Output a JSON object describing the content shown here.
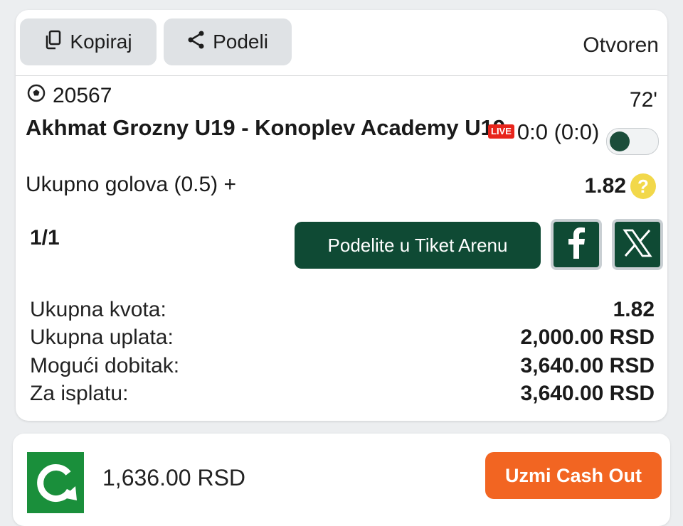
{
  "ticket": {
    "copy_label": "Kopiraj",
    "share_label": "Podeli",
    "status": "Otvoren"
  },
  "event": {
    "id": "20567",
    "minute": "72'",
    "title": "Akhmat Grozny U19 - Konoplev Academy U19",
    "live_badge": "LIVE",
    "score": "0:0 (0:0)",
    "market": "Ukupno golova (0.5) +",
    "odds": "1.82"
  },
  "actions": {
    "count": "1/1",
    "arena_label": "Podelite u Tiket Arenu",
    "facebook_icon": "facebook-icon",
    "x_icon": "x-icon"
  },
  "summary": [
    {
      "label": "Ukupna kvota:",
      "value": "1.82"
    },
    {
      "label": "Ukupna uplata:",
      "value": "2,000.00 RSD"
    },
    {
      "label": "Mogući dobitak:",
      "value": "3,640.00 RSD"
    },
    {
      "label": "Za isplatu:",
      "value": "3,640.00 RSD"
    }
  ],
  "cashout": {
    "amount": "1,636.00 RSD",
    "button_label": "Uzmi Cash Out"
  },
  "colors": {
    "primary_green": "#0f4a34",
    "cashout_orange": "#f26522",
    "live_red": "#e8251c",
    "help_yellow": "#f2d84a"
  }
}
